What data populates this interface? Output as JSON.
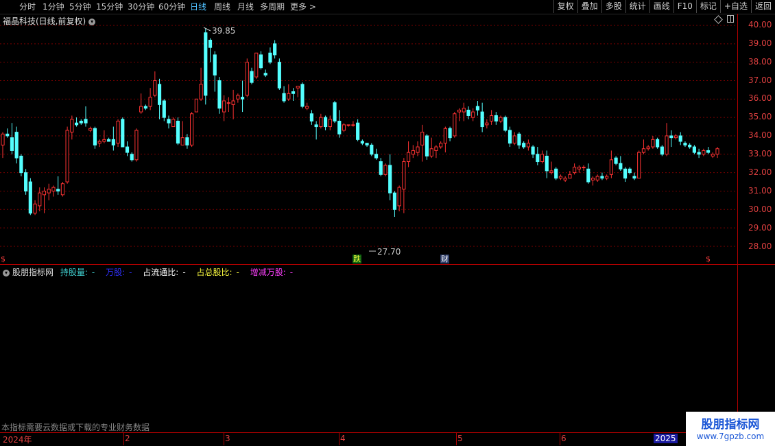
{
  "toolbar": {
    "periods": [
      "分时",
      "1分钟",
      "5分钟",
      "15分钟",
      "30分钟",
      "60分钟",
      "日线",
      "周线",
      "月线",
      "多周期",
      "更多 >"
    ],
    "active_period": "日线",
    "buttons": [
      "复权",
      "叠加",
      "多股",
      "统计",
      "画线",
      "F10",
      "标记",
      "+自选",
      "返回"
    ]
  },
  "chart": {
    "title": "福晶科技(日线,前复权)",
    "high_annotation": "39.85",
    "low_annotation": "27.70",
    "y_axis": [
      "40.00",
      "39.00",
      "38.00",
      "37.00",
      "36.00",
      "35.00",
      "34.00",
      "33.00",
      "32.00",
      "31.00",
      "30.00",
      "29.00",
      "28.00"
    ],
    "markers": {
      "s": "$",
      "die": "跌",
      "cai": "财"
    },
    "colors": {
      "up": "#ff3333",
      "down": "#54ffff",
      "grid": "#7a0000",
      "axis": "#b00000"
    }
  },
  "indicator": {
    "name": "股朋指标网",
    "fields": [
      {
        "label": "持股量:",
        "value": "-"
      },
      {
        "label": "万股:",
        "value": "-"
      },
      {
        "label": "占流通比:",
        "value": "-"
      },
      {
        "label": "占总股比:",
        "value": "-"
      },
      {
        "label": "增减万股:",
        "value": "-"
      }
    ],
    "note": "本指标需要云数据或下载的专业财务数据"
  },
  "timeline": {
    "labels": [
      "2024年",
      "2",
      "3",
      "4",
      "5",
      "6",
      "2025"
    ]
  },
  "watermark": {
    "title": "股朋指标网",
    "url": "www.7gpzb.com"
  },
  "chart_data": {
    "type": "candlestick",
    "y_range": [
      27.5,
      40.2
    ],
    "candles": [
      [
        33.5,
        34.2,
        32.8,
        34.1
      ],
      [
        34.1,
        34.4,
        33.9,
        34.0
      ],
      [
        33.9,
        34.7,
        33.0,
        33.2
      ],
      [
        34.2,
        34.5,
        32.5,
        32.8
      ],
      [
        32.9,
        33.0,
        31.8,
        32.0
      ],
      [
        32.0,
        32.2,
        30.8,
        31.0
      ],
      [
        31.5,
        31.7,
        29.7,
        29.8
      ],
      [
        29.8,
        30.5,
        29.7,
        30.3
      ],
      [
        30.2,
        31.2,
        29.9,
        30.9
      ],
      [
        30.8,
        31.2,
        29.8,
        31.0
      ],
      [
        30.9,
        31.4,
        30.5,
        31.1
      ],
      [
        31.0,
        31.3,
        30.7,
        31.2
      ],
      [
        31.1,
        31.8,
        30.8,
        31.0
      ],
      [
        30.8,
        31.5,
        30.7,
        31.4
      ],
      [
        31.5,
        34.5,
        31.4,
        34.3
      ],
      [
        34.2,
        35.1,
        33.8,
        34.9
      ],
      [
        34.7,
        35.0,
        34.5,
        34.6
      ],
      [
        34.8,
        34.9,
        34.6,
        34.7
      ],
      [
        34.9,
        35.6,
        34.5,
        34.7
      ],
      [
        34.3,
        34.5,
        34.2,
        34.4
      ],
      [
        34.4,
        34.5,
        33.3,
        33.5
      ],
      [
        33.6,
        33.8,
        33.4,
        33.7
      ],
      [
        33.7,
        34.3,
        33.6,
        33.8
      ],
      [
        33.8,
        33.9,
        33.7,
        33.7
      ],
      [
        33.8,
        34.5,
        33.2,
        33.5
      ],
      [
        33.6,
        34.9,
        33.4,
        34.8
      ],
      [
        34.9,
        35.0,
        33.4,
        33.4
      ],
      [
        33.4,
        33.7,
        32.9,
        33.1
      ],
      [
        33.0,
        33.1,
        32.6,
        32.7
      ],
      [
        32.7,
        34.4,
        32.6,
        34.3
      ],
      [
        35.3,
        36.3,
        35.2,
        35.6
      ],
      [
        35.6,
        35.7,
        35.4,
        35.5
      ],
      [
        35.6,
        36.6,
        35.4,
        36.1
      ],
      [
        36.2,
        37.5,
        36.1,
        37.0
      ],
      [
        36.8,
        37.1,
        34.9,
        35.7
      ],
      [
        35.9,
        36.0,
        34.8,
        35.0
      ],
      [
        34.9,
        35.1,
        34.4,
        34.7
      ],
      [
        34.5,
        35.0,
        34.5,
        34.9
      ],
      [
        34.8,
        35.0,
        33.5,
        33.6
      ],
      [
        33.5,
        34.8,
        33.5,
        33.9
      ],
      [
        33.9,
        34.1,
        33.3,
        33.5
      ],
      [
        33.5,
        35.3,
        33.4,
        35.2
      ],
      [
        35.3,
        36.0,
        35.3,
        36.0
      ],
      [
        36.0,
        37.7,
        35.9,
        36.8
      ],
      [
        39.6,
        39.85,
        35.7,
        36.2
      ],
      [
        39.2,
        39.3,
        38.0,
        38.8
      ],
      [
        38.4,
        38.6,
        36.4,
        37.3
      ],
      [
        37.0,
        37.2,
        35.2,
        35.5
      ],
      [
        35.3,
        36.2,
        34.8,
        35.9
      ],
      [
        35.8,
        36.1,
        35.3,
        35.8
      ],
      [
        35.7,
        36.5,
        34.9,
        35.9
      ],
      [
        36.0,
        36.3,
        35.8,
        36.2
      ],
      [
        36.1,
        37.0,
        35.3,
        36.0
      ],
      [
        36.2,
        38.2,
        36.1,
        38.0
      ],
      [
        37.5,
        37.7,
        36.8,
        36.9
      ],
      [
        37.2,
        38.5,
        37.1,
        38.5
      ],
      [
        38.4,
        38.6,
        37.6,
        37.7
      ],
      [
        37.4,
        37.6,
        37.2,
        37.3
      ],
      [
        38.5,
        38.8,
        37.9,
        38.0
      ],
      [
        39.0,
        39.2,
        38.2,
        38.4
      ],
      [
        38.0,
        38.2,
        36.5,
        36.6
      ],
      [
        36.3,
        36.7,
        35.8,
        35.9
      ],
      [
        36.0,
        36.8,
        35.9,
        36.3
      ],
      [
        36.4,
        36.6,
        35.9,
        36.3
      ],
      [
        36.6,
        36.7,
        36.1,
        36.7
      ],
      [
        36.8,
        36.9,
        35.5,
        35.6
      ],
      [
        35.5,
        35.8,
        35.4,
        35.6
      ],
      [
        35.2,
        35.4,
        34.6,
        34.8
      ],
      [
        34.6,
        34.8,
        33.8,
        34.5
      ],
      [
        34.5,
        35.2,
        34.4,
        35.0
      ],
      [
        35.0,
        35.1,
        34.3,
        34.5
      ],
      [
        34.5,
        35.1,
        34.3,
        34.9
      ],
      [
        35.8,
        35.9,
        34.7,
        34.8
      ],
      [
        34.8,
        35.4,
        33.9,
        34.1
      ],
      [
        34.3,
        34.7,
        34.2,
        34.6
      ],
      [
        34.6,
        34.6,
        34.5,
        34.6
      ],
      [
        34.6,
        34.8,
        34.5,
        34.6
      ],
      [
        34.7,
        34.9,
        33.7,
        33.8
      ],
      [
        33.7,
        33.8,
        33.5,
        33.6
      ],
      [
        33.6,
        33.6,
        33.4,
        33.5
      ],
      [
        33.5,
        33.6,
        32.9,
        33.0
      ],
      [
        33.0,
        33.3,
        32.7,
        32.8
      ],
      [
        32.6,
        32.8,
        31.8,
        31.9
      ],
      [
        31.9,
        32.5,
        31.8,
        32.4
      ],
      [
        32.4,
        33.0,
        30.5,
        30.9
      ],
      [
        30.9,
        31.0,
        29.6,
        30.0
      ],
      [
        30.2,
        31.3,
        29.9,
        31.2
      ],
      [
        31.1,
        32.8,
        29.8,
        32.6
      ],
      [
        32.6,
        33.7,
        32.3,
        33.1
      ],
      [
        33.0,
        33.5,
        32.8,
        33.2
      ],
      [
        33.1,
        33.7,
        32.9,
        33.4
      ],
      [
        33.5,
        34.6,
        32.6,
        34.2
      ],
      [
        34.0,
        34.1,
        32.7,
        32.9
      ],
      [
        32.9,
        33.9,
        32.8,
        33.3
      ],
      [
        33.2,
        33.5,
        32.8,
        33.4
      ],
      [
        33.4,
        33.7,
        33.3,
        33.6
      ],
      [
        33.6,
        34.5,
        33.1,
        34.4
      ],
      [
        34.4,
        34.5,
        33.7,
        33.9
      ],
      [
        34.0,
        35.3,
        33.9,
        35.2
      ],
      [
        35.3,
        35.5,
        34.8,
        35.4
      ],
      [
        35.3,
        35.8,
        34.8,
        35.5
      ],
      [
        35.4,
        35.6,
        34.9,
        35.1
      ],
      [
        35.0,
        35.5,
        34.8,
        35.3
      ],
      [
        35.6,
        35.9,
        35.1,
        35.4
      ],
      [
        35.3,
        35.8,
        34.2,
        34.5
      ],
      [
        34.6,
        34.9,
        34.4,
        34.7
      ],
      [
        34.8,
        35.4,
        34.6,
        35.1
      ],
      [
        35.1,
        35.3,
        34.6,
        34.8
      ],
      [
        34.8,
        35.1,
        34.7,
        35.0
      ],
      [
        35.0,
        35.1,
        34.2,
        34.3
      ],
      [
        34.3,
        34.5,
        33.4,
        33.6
      ],
      [
        33.6,
        34.2,
        33.5,
        34.0
      ],
      [
        34.1,
        34.2,
        33.3,
        33.5
      ],
      [
        33.6,
        33.7,
        33.3,
        33.4
      ],
      [
        33.4,
        33.8,
        33.2,
        33.6
      ],
      [
        33.4,
        33.5,
        32.8,
        33.0
      ],
      [
        33.0,
        33.4,
        32.4,
        32.6
      ],
      [
        32.6,
        33.2,
        32.5,
        33.0
      ],
      [
        32.9,
        33.2,
        31.7,
        32.1
      ],
      [
        32.0,
        32.6,
        31.9,
        32.1
      ],
      [
        32.2,
        32.3,
        31.6,
        31.7
      ],
      [
        31.7,
        31.9,
        31.6,
        31.8
      ],
      [
        31.6,
        31.8,
        31.5,
        31.7
      ],
      [
        31.7,
        32.1,
        31.7,
        31.9
      ],
      [
        32.0,
        32.5,
        31.9,
        32.3
      ],
      [
        32.2,
        32.4,
        32.0,
        32.3
      ],
      [
        32.3,
        32.4,
        32.1,
        32.3
      ],
      [
        32.2,
        32.5,
        31.4,
        31.5
      ],
      [
        31.6,
        31.8,
        31.3,
        31.7
      ],
      [
        31.6,
        31.9,
        31.5,
        31.8
      ],
      [
        31.8,
        32.0,
        31.6,
        31.7
      ],
      [
        31.7,
        31.9,
        31.6,
        31.8
      ],
      [
        31.9,
        33.2,
        31.7,
        32.7
      ],
      [
        32.8,
        32.9,
        32.4,
        32.5
      ],
      [
        32.5,
        32.9,
        32.1,
        32.2
      ],
      [
        32.2,
        32.3,
        31.5,
        31.7
      ],
      [
        32.2,
        32.3,
        31.9,
        32.0
      ],
      [
        31.8,
        32.0,
        31.6,
        31.7
      ],
      [
        31.7,
        33.2,
        31.7,
        33.1
      ],
      [
        33.1,
        33.8,
        33.0,
        33.3
      ],
      [
        33.3,
        33.5,
        33.2,
        33.4
      ],
      [
        33.4,
        34.0,
        33.3,
        33.8
      ],
      [
        33.8,
        33.9,
        33.3,
        33.4
      ],
      [
        33.4,
        33.5,
        32.9,
        33.0
      ],
      [
        33.0,
        34.7,
        32.9,
        34.0
      ],
      [
        34.0,
        34.3,
        33.4,
        33.9
      ],
      [
        33.9,
        34.1,
        33.8,
        34.0
      ],
      [
        34.0,
        34.2,
        33.5,
        33.7
      ],
      [
        33.6,
        33.7,
        33.4,
        33.5
      ],
      [
        33.5,
        33.6,
        33.3,
        33.4
      ],
      [
        33.4,
        33.5,
        33.0,
        33.1
      ],
      [
        33.1,
        33.3,
        32.8,
        33.0
      ],
      [
        33.0,
        33.3,
        32.9,
        33.2
      ],
      [
        33.2,
        33.4,
        33.0,
        33.1
      ],
      [
        32.9,
        33.1,
        32.8,
        33.0
      ],
      [
        33.0,
        33.4,
        32.8,
        33.3
      ]
    ]
  }
}
